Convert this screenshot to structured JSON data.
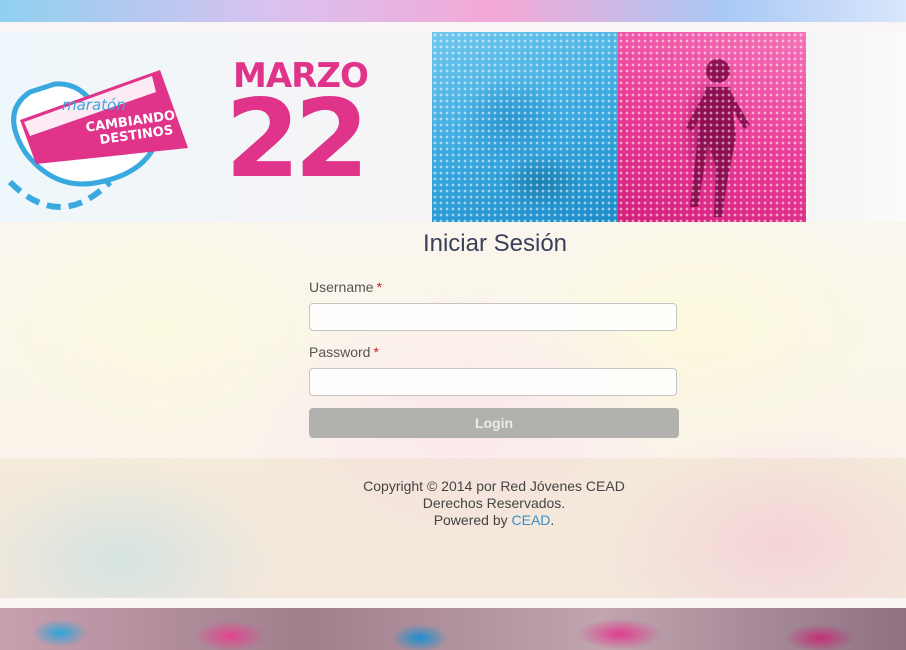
{
  "banner": {
    "logo_word_top": "maratón",
    "logo_word_1": "CAMBIANDO",
    "logo_word_2": "DESTINOS",
    "date_month": "MARZO",
    "date_day": "22"
  },
  "login": {
    "title": "Iniciar Sesión",
    "username_label": "Username",
    "password_label": "Password",
    "required_mark": "*",
    "username_value": "",
    "password_value": "",
    "button_label": "Login"
  },
  "footer": {
    "copyright": "Copyright © 2014 por Red Jóvenes CEAD",
    "rights": "Derechos Reservados.",
    "powered_prefix": "Powered by ",
    "powered_link": "CEAD",
    "powered_suffix": "."
  },
  "colors": {
    "accent_pink": "#e0338a",
    "accent_blue": "#3aa9e0",
    "link": "#3a8fc8",
    "button": "#b3b1ad"
  }
}
